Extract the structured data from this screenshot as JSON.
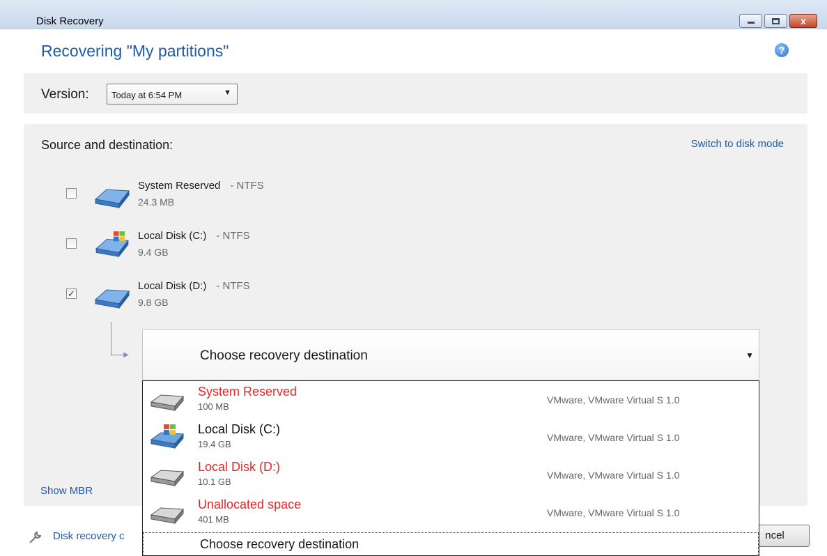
{
  "window": {
    "title": "Disk Recovery",
    "controls": {
      "minimize": "minimize",
      "maximize": "maximize",
      "close": "x"
    }
  },
  "header": {
    "title": "Recovering \"My partitions\"",
    "help_icon": "?"
  },
  "version": {
    "label": "Version:",
    "selected": "Today at 6:54 PM"
  },
  "source_destination": {
    "label": "Source and destination:",
    "switch_link": "Switch to disk mode",
    "partitions": [
      {
        "name": "System Reserved",
        "fs": "- NTFS",
        "size": "24.3 MB",
        "checked": false,
        "icon": "drive-icon"
      },
      {
        "name": "Local Disk (C:)",
        "fs": "- NTFS",
        "size": "9.4 GB",
        "checked": false,
        "icon": "windows-drive-icon"
      },
      {
        "name": "Local Disk (D:)",
        "fs": "- NTFS",
        "size": "9.8 GB",
        "checked": true,
        "check_mark": "✓",
        "icon": "drive-icon"
      }
    ]
  },
  "destination": {
    "placeholder": "Choose recovery destination",
    "options": [
      {
        "name": "System Reserved",
        "size": "100 MB",
        "disk": "VMware, VMware Virtual S 1.0",
        "state": "red",
        "icon": "drive-icon"
      },
      {
        "name": "Local Disk (C:)",
        "size": "19.4 GB",
        "disk": "VMware, VMware Virtual S 1.0",
        "state": "black",
        "icon": "windows-drive-icon"
      },
      {
        "name": "Local Disk (D:)",
        "size": "10.1 GB",
        "disk": "VMware, VMware Virtual S 1.0",
        "state": "red",
        "icon": "drive-icon"
      },
      {
        "name": "Unallocated space",
        "size": "401 MB",
        "disk": "VMware, VMware Virtual S 1.0",
        "state": "red",
        "icon": "drive-icon"
      }
    ],
    "selected_label": "Choose recovery destination"
  },
  "show_mbr": "Show MBR",
  "footer": {
    "recovery_link": "Disk recovery c",
    "cancel": "ncel"
  },
  "colors": {
    "accent": "#1d5aa8",
    "error": "#e32828",
    "panel": "#f0f0f0"
  }
}
